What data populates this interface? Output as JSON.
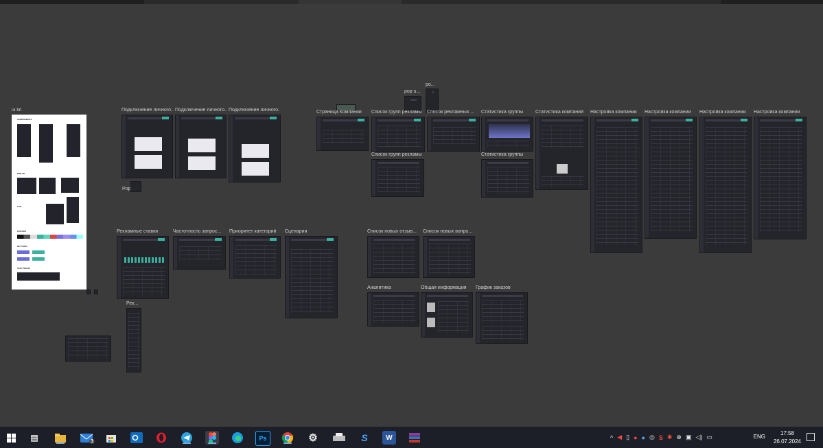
{
  "canvas": {
    "ui_kit_label": "ui kit",
    "ui_kit_sections": [
      "COMPONENTS",
      "POP UP",
      "TAB",
      "COLORS",
      "BUTTONS",
      "TEXT FIELDS"
    ],
    "frames": [
      {
        "label": "Подключение личного..."
      },
      {
        "label": "Подключение личного..."
      },
      {
        "label": "Подключение личного..."
      },
      {
        "label": "Страница Компании"
      },
      {
        "label": "Список групп рекламы"
      },
      {
        "label": "Список рекламных ..."
      },
      {
        "label": "Статистика группы"
      },
      {
        "label": "Статистика компаний"
      },
      {
        "label": "Настройка компании"
      },
      {
        "label": "Настройка компании"
      },
      {
        "label": "Настройка компании"
      },
      {
        "label": "Настройка компании"
      },
      {
        "label": "Список групп рекламы"
      },
      {
        "label": "Статистика группы"
      },
      {
        "label": "Рекламные ставки"
      },
      {
        "label": "Частотность запрос..."
      },
      {
        "label": "Приоритет категорий"
      },
      {
        "label": "Сценарии"
      },
      {
        "label": "Список новых отзыв..."
      },
      {
        "label": "Список новых вопро..."
      },
      {
        "label": "Аналитика"
      },
      {
        "label": "Общая информация"
      },
      {
        "label": "График заказов"
      },
      {
        "label": "Рек..."
      },
      {
        "label": "pop u..."
      },
      {
        "label": "po..."
      },
      {
        "label": "Pop..."
      }
    ]
  },
  "taskbar": {
    "apps": [
      {
        "name": "start-icon"
      },
      {
        "name": "task-view-icon"
      },
      {
        "name": "file-explorer-icon"
      },
      {
        "name": "mail-icon",
        "badge": "3"
      },
      {
        "name": "store-icon"
      },
      {
        "name": "outlook-icon"
      },
      {
        "name": "opera-icon"
      },
      {
        "name": "telegram-icon"
      },
      {
        "name": "figma-icon"
      },
      {
        "name": "edge-icon"
      },
      {
        "name": "photoshop-icon",
        "text": "Ps"
      },
      {
        "name": "chrome-icon"
      },
      {
        "name": "settings-icon"
      },
      {
        "name": "printer-icon"
      },
      {
        "name": "app-s-icon"
      },
      {
        "name": "word-icon",
        "text": "W"
      },
      {
        "name": "winrar-icon"
      }
    ],
    "language": "ENG",
    "time": "17:58",
    "date": "26.07.2024"
  }
}
